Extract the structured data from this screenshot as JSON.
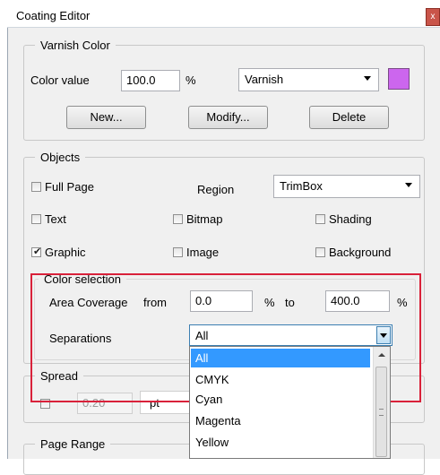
{
  "window": {
    "title": "Coating Editor",
    "close_glyph": "x"
  },
  "varnish": {
    "legend": "Varnish Color",
    "color_value_label": "Color value",
    "color_value": "100.0",
    "percent": "%",
    "combo_value": "Varnish",
    "swatch_color": "#cc66ee",
    "buttons": {
      "new": "New...",
      "modify": "Modify...",
      "delete": "Delete"
    }
  },
  "objects": {
    "legend": "Objects",
    "full_page": "Full Page",
    "region_label": "Region",
    "region_value": "TrimBox",
    "text": "Text",
    "bitmap": "Bitmap",
    "shading": "Shading",
    "graphic": "Graphic",
    "graphic_checked": true,
    "image": "Image",
    "background": "Background"
  },
  "color_selection": {
    "legend": "Color selection",
    "area_label": "Area Coverage",
    "from_label": "from",
    "from_value": "0.0",
    "pct1": "%",
    "to_label": "to",
    "to_value": "400.0",
    "pct2": "%",
    "separations_label": "Separations",
    "separations_value": "All"
  },
  "separations_dropdown": {
    "items": [
      "All",
      "CMYK",
      "Cyan",
      "Magenta",
      "Yellow"
    ],
    "selected_index": 0
  },
  "spread": {
    "legend": "Spread",
    "value": "0.20",
    "unit": "pt"
  },
  "page_range": {
    "legend": "Page Range"
  }
}
